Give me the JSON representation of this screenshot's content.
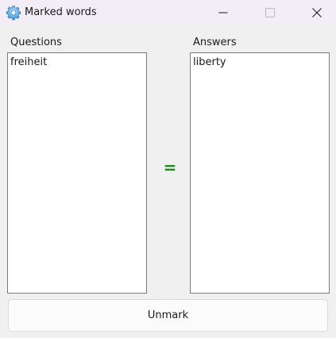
{
  "window": {
    "title": "Marked words",
    "icon": "gear-icon",
    "controls": {
      "minimize": "minimize-icon",
      "maximize": "maximize-icon",
      "close": "close-icon"
    }
  },
  "questions": {
    "label": "Questions",
    "items": [
      "freiheit"
    ]
  },
  "answers": {
    "label": "Answers",
    "items": [
      "liberty"
    ]
  },
  "separator": "=",
  "unmark_button": {
    "label": "Unmark"
  },
  "colors": {
    "equals": "#1f8a1f",
    "titlebar": "#f3eef6",
    "window_bg": "#f0f0f0"
  }
}
